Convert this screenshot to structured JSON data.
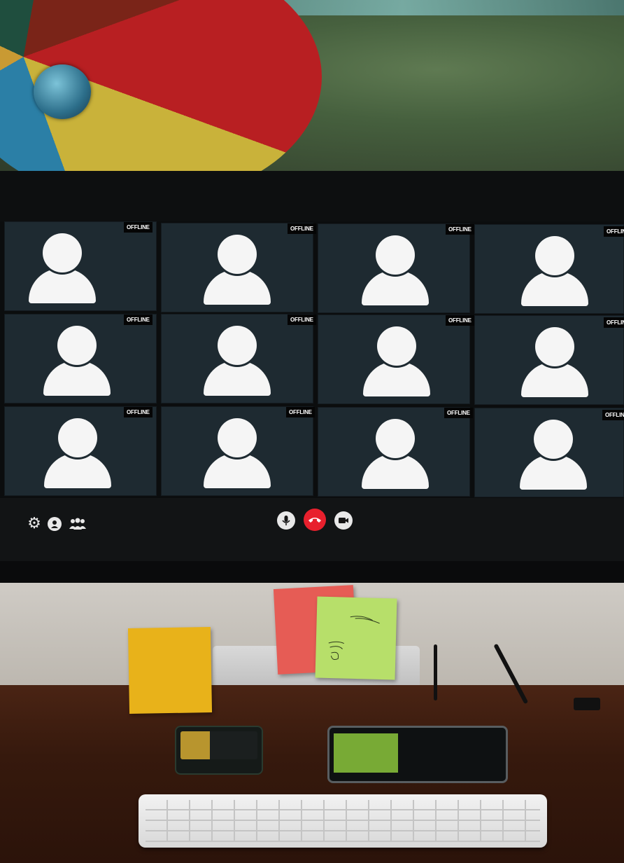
{
  "video_call": {
    "participants": [
      {
        "status": "OFFLINE"
      },
      {
        "status": "OFFLINE"
      },
      {
        "status": "OFFLINE"
      },
      {
        "status": "OFFLINE"
      },
      {
        "status": "OFFLINE"
      },
      {
        "status": "OFFLINE"
      },
      {
        "status": "OFFLINE"
      },
      {
        "status": "OFFLINE"
      },
      {
        "status": "OFFLINE"
      },
      {
        "status": "OFFLINE"
      },
      {
        "status": "OFFLINE"
      },
      {
        "status": "OFFLINE"
      }
    ],
    "left_controls": [
      {
        "icon": "gear-icon"
      },
      {
        "icon": "user-icon"
      },
      {
        "icon": "users-icon"
      }
    ],
    "center_controls": [
      {
        "icon": "microphone-icon"
      },
      {
        "icon": "hang-up-icon",
        "color": "#e8202d"
      },
      {
        "icon": "video-camera-icon"
      }
    ]
  },
  "colors": {
    "tile_background": "#1e2a31",
    "avatar": "#f5f5f5",
    "hangup": "#e8202d"
  }
}
